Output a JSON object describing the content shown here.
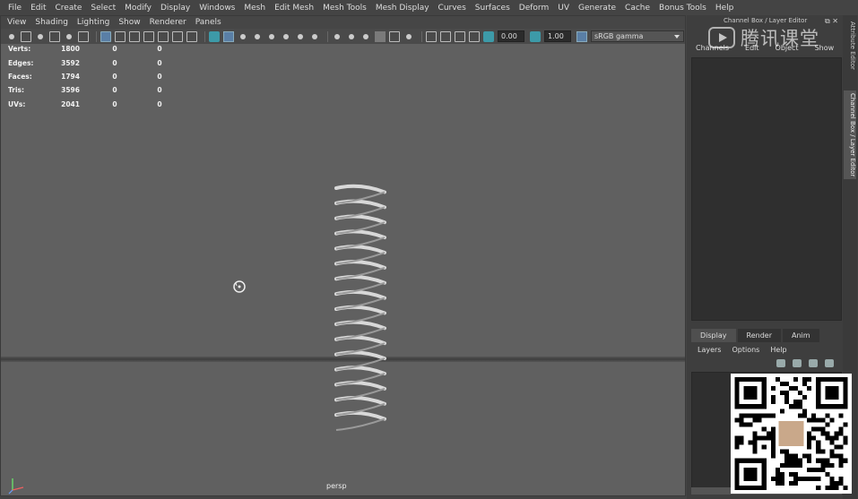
{
  "main_menu": [
    "File",
    "Edit",
    "Create",
    "Select",
    "Modify",
    "Display",
    "Windows",
    "Mesh",
    "Edit Mesh",
    "Mesh Tools",
    "Mesh Display",
    "Curves",
    "Surfaces",
    "Deform",
    "UV",
    "Generate",
    "Cache",
    "Bonus Tools",
    "Help"
  ],
  "panel_menu": [
    "View",
    "Shading",
    "Lighting",
    "Show",
    "Renderer",
    "Panels"
  ],
  "toolbar": {
    "exposure_value": "0.00",
    "gamma_value": "1.00",
    "color_space": "sRGB gamma"
  },
  "hud": {
    "rows": [
      {
        "label": "Verts:",
        "v1": "1800",
        "v2": "0",
        "v3": "0"
      },
      {
        "label": "Edges:",
        "v1": "3592",
        "v2": "0",
        "v3": "0"
      },
      {
        "label": "Faces:",
        "v1": "1794",
        "v2": "0",
        "v3": "0"
      },
      {
        "label": "Tris:",
        "v1": "3596",
        "v2": "0",
        "v3": "0"
      },
      {
        "label": "UVs:",
        "v1": "2041",
        "v2": "0",
        "v3": "0"
      }
    ]
  },
  "viewport": {
    "camera_label": "persp"
  },
  "channel_box": {
    "title": "Channel Box / Layer Editor",
    "menus": [
      "Channels",
      "Edit",
      "Object",
      "Show"
    ]
  },
  "side_tabs": {
    "attribute_editor": "Attribute Editor",
    "channel_box": "Channel Box / Layer Editor"
  },
  "layer_editor": {
    "tabs": [
      "Display",
      "Render",
      "Anim"
    ],
    "menus": [
      "Layers",
      "Options",
      "Help"
    ]
  },
  "watermark": {
    "text": "腾讯课堂"
  },
  "colors": {
    "viewport_bg": "#606060",
    "ui_bg": "#444444",
    "accent": "#5a7fa6",
    "teal": "#3d9aa8"
  }
}
